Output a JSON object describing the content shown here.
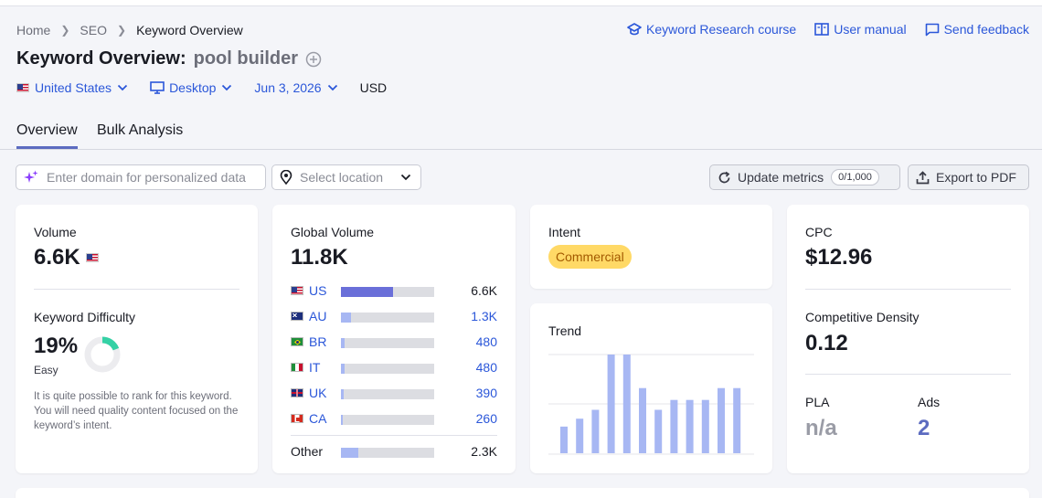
{
  "breadcrumb": [
    "Home",
    "SEO",
    "Keyword Overview"
  ],
  "top_links": {
    "course": "Keyword Research course",
    "manual": "User manual",
    "feedback": "Send feedback"
  },
  "page": {
    "title": "Keyword Overview:",
    "keyword": "pool builder"
  },
  "filters": {
    "country": "United States",
    "device": "Desktop",
    "date": "Jun 3, 2026",
    "currency": "USD"
  },
  "tabs": [
    "Overview",
    "Bulk Analysis"
  ],
  "toolbar": {
    "domain_placeholder": "Enter domain for personalized data",
    "location_placeholder": "Select location",
    "update_label": "Update metrics",
    "update_count": "0/1,000",
    "export_label": "Export to PDF"
  },
  "volume": {
    "label": "Volume",
    "value": "6.6K"
  },
  "difficulty": {
    "label": "Keyword Difficulty",
    "value": "19%",
    "percent": 19,
    "level": "Easy",
    "description": "It is quite possible to rank for this keyword. You will need quality content focused on the keyword’s intent."
  },
  "global_volume": {
    "label": "Global Volume",
    "value": "11.8K",
    "rows": [
      {
        "code": "US",
        "value": "6.6K",
        "share": 0.56
      },
      {
        "code": "AU",
        "value": "1.3K",
        "share": 0.11
      },
      {
        "code": "BR",
        "value": "480",
        "share": 0.04
      },
      {
        "code": "IT",
        "value": "480",
        "share": 0.04
      },
      {
        "code": "UK",
        "value": "390",
        "share": 0.033
      },
      {
        "code": "CA",
        "value": "260",
        "share": 0.022
      }
    ],
    "other": {
      "label": "Other",
      "value": "2.3K",
      "share": 0.19
    }
  },
  "intent": {
    "label": "Intent",
    "value": "Commercial"
  },
  "trend": {
    "label": "Trend",
    "values": [
      0.27,
      0.35,
      0.44,
      1.0,
      1.0,
      0.66,
      0.44,
      0.54,
      0.54,
      0.54,
      0.66,
      0.66
    ]
  },
  "cpc": {
    "label": "CPC",
    "value": "$12.96"
  },
  "competitive_density": {
    "label": "Competitive Density",
    "value": "0.12"
  },
  "pla": {
    "label": "PLA",
    "value": "n/a"
  },
  "ads": {
    "label": "Ads",
    "value": "2"
  },
  "colors": {
    "link": "#2b57d9",
    "bar_dark": "#6a6fd9",
    "bar_light": "#a7b7f3",
    "difficulty_ring": "#35d1a5",
    "intent_pill": "#ffd966"
  }
}
